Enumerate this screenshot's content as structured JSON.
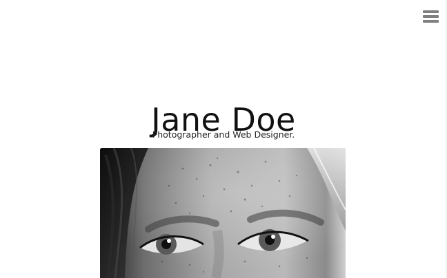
{
  "header": {
    "menu_icon": "hamburger-menu-icon",
    "menu_color": "#808080"
  },
  "hero": {
    "title": "Jane Doe",
    "subtitle": "Photographer and Web Designer."
  },
  "image": {
    "subject": "black-and-white close-up portrait"
  }
}
